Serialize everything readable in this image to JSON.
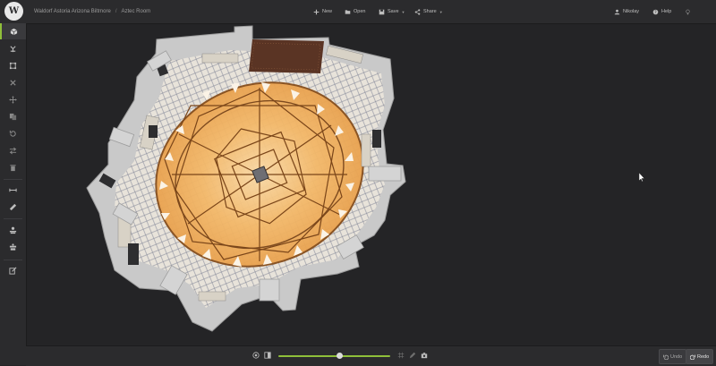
{
  "app": {
    "logo_text": "W"
  },
  "breadcrumb": {
    "project": "Waldorf Astoria Arizona Biltmore",
    "separator": "/",
    "room": "Aztec Room"
  },
  "toolbar": {
    "new_label": "New",
    "open_label": "Open",
    "save_label": "Save",
    "share_label": "Share",
    "user_label": "Nikolay",
    "help_label": "Help"
  },
  "sidebar": {
    "tools": [
      {
        "icon": "cube-icon",
        "active": true
      },
      {
        "icon": "furniture-icon"
      },
      {
        "icon": "select-box-icon"
      },
      {
        "icon": "close-icon"
      },
      {
        "icon": "move-icon"
      },
      {
        "icon": "copy-icon"
      },
      {
        "icon": "rotate-icon"
      },
      {
        "icon": "swap-icon"
      },
      {
        "icon": "trash-icon"
      },
      {
        "icon": "measure-icon"
      },
      {
        "icon": "ruler-icon"
      },
      {
        "icon": "people-icon"
      },
      {
        "icon": "table-icon"
      },
      {
        "icon": "edit-icon"
      }
    ]
  },
  "view": {
    "zoom_level": 0.55
  },
  "history": {
    "undo_label": "Undo",
    "redo_label": "Redo"
  },
  "colors": {
    "accent": "#8fbf3a",
    "floor_light": "#f4c27a",
    "floor_dark": "#c86a1e",
    "wall": "#c9c9c9"
  }
}
